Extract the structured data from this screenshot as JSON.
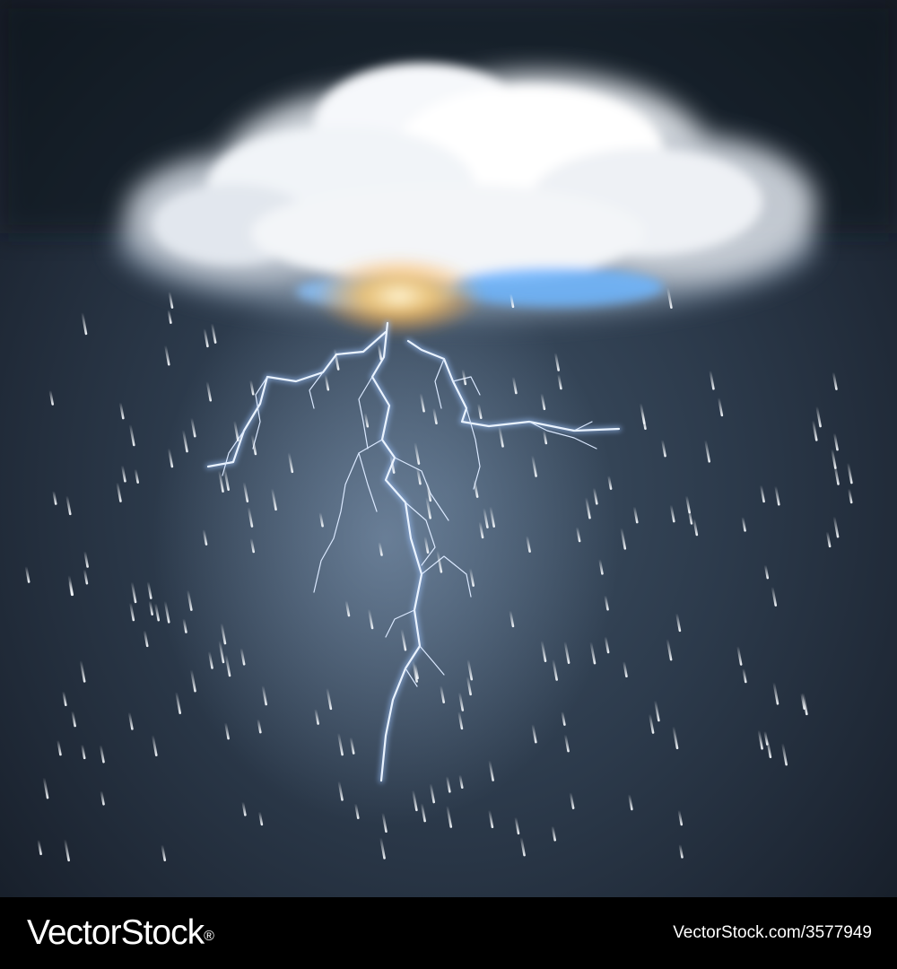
{
  "scene": {
    "subject": "storm-cloud-with-lightning-and-rain",
    "colors": {
      "sky": "#2c3a4b",
      "cloud": "#f2f4f7",
      "glow": "#ffd27a",
      "lightning": "#e8f2ff",
      "rain": "#dfe8f2"
    }
  },
  "footer": {
    "brand": "VectorStock",
    "brand_mark": "®",
    "credit": "VectorStock.com/3577949"
  }
}
